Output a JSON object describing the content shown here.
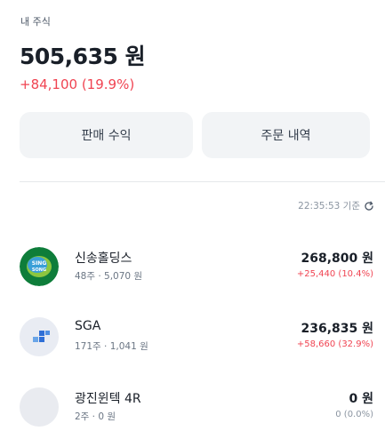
{
  "header": {
    "label": "내 주식",
    "total_value": "505,635 원",
    "total_change": "+84,100 (19.9%)"
  },
  "buttons": {
    "sales_profit": "판매 수익",
    "order_history": "주문 내역"
  },
  "timestamp": "22:35:53 기준",
  "logo_text": {
    "sinsong_top": "SING",
    "sinsong_bottom": "SONG"
  },
  "stocks": [
    {
      "name": "신송홀딩스",
      "meta": "48주 · 5,070 원",
      "value": "268,800 원",
      "change": "+25,440 (10.4%)"
    },
    {
      "name": "SGA",
      "meta": "171주 · 1,041 원",
      "value": "236,835 원",
      "change": "+58,660 (32.9%)"
    },
    {
      "name": "광진윈텍 4R",
      "meta": "2주 · 0 원",
      "value": "0 원",
      "change": "0 (0.0%)"
    }
  ],
  "colors": {
    "up": "#f04452",
    "neutral": "#8b95a1",
    "button_bg": "#f2f4f6"
  }
}
